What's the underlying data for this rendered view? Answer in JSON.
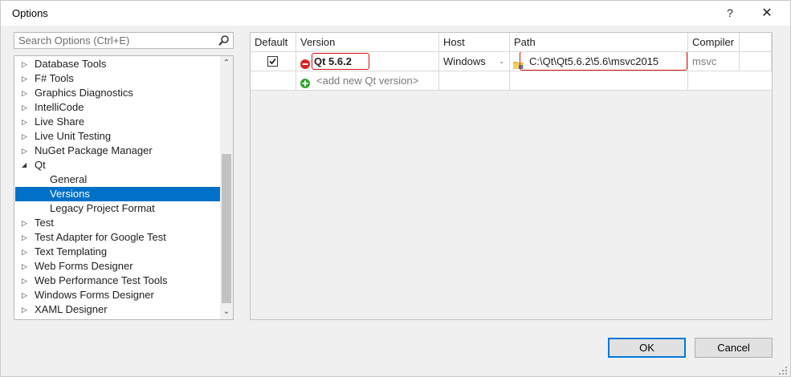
{
  "window": {
    "title": "Options",
    "help_label": "?",
    "close_label": "✕"
  },
  "search": {
    "placeholder": "Search Options (Ctrl+E)"
  },
  "tree": {
    "items": [
      {
        "label": "Database Tools",
        "level": 0,
        "expander": "collapsed"
      },
      {
        "label": "F# Tools",
        "level": 0,
        "expander": "collapsed"
      },
      {
        "label": "Graphics Diagnostics",
        "level": 0,
        "expander": "collapsed"
      },
      {
        "label": "IntelliCode",
        "level": 0,
        "expander": "collapsed"
      },
      {
        "label": "Live Share",
        "level": 0,
        "expander": "collapsed"
      },
      {
        "label": "Live Unit Testing",
        "level": 0,
        "expander": "collapsed"
      },
      {
        "label": "NuGet Package Manager",
        "level": 0,
        "expander": "collapsed"
      },
      {
        "label": "Qt",
        "level": 0,
        "expander": "expanded"
      },
      {
        "label": "General",
        "level": 1,
        "expander": "none"
      },
      {
        "label": "Versions",
        "level": 1,
        "expander": "none",
        "selected": true
      },
      {
        "label": "Legacy Project Format",
        "level": 1,
        "expander": "none"
      },
      {
        "label": "Test",
        "level": 0,
        "expander": "collapsed"
      },
      {
        "label": "Test Adapter for Google Test",
        "level": 0,
        "expander": "collapsed"
      },
      {
        "label": "Text Templating",
        "level": 0,
        "expander": "collapsed"
      },
      {
        "label": "Web Forms Designer",
        "level": 0,
        "expander": "collapsed"
      },
      {
        "label": "Web Performance Test Tools",
        "level": 0,
        "expander": "collapsed"
      },
      {
        "label": "Windows Forms Designer",
        "level": 0,
        "expander": "collapsed"
      },
      {
        "label": "XAML Designer",
        "level": 0,
        "expander": "collapsed"
      }
    ],
    "arrows": {
      "collapsed": "▷",
      "expanded": "◢",
      "up": "⌃",
      "down": "⌄"
    }
  },
  "versions_table": {
    "headers": {
      "default": "Default",
      "version": "Version",
      "host": "Host",
      "path": "Path",
      "compiler": "Compiler"
    },
    "rows": [
      {
        "default_checked": true,
        "version": "Qt 5.6.2",
        "host": "Windows",
        "path": "C:\\Qt\\Qt5.6.2\\5.6\\msvc2015",
        "compiler": "msvc"
      }
    ],
    "add_row_label": "<add new Qt version>",
    "host_dropdown_arrow": "⌄"
  },
  "buttons": {
    "ok": "OK",
    "cancel": "Cancel"
  },
  "colors": {
    "selection": "#0070c8",
    "error_outline": "#e01010",
    "accent_border": "#0078d7",
    "add_icon": "#2ea52e",
    "error_icon": "#e02020"
  }
}
